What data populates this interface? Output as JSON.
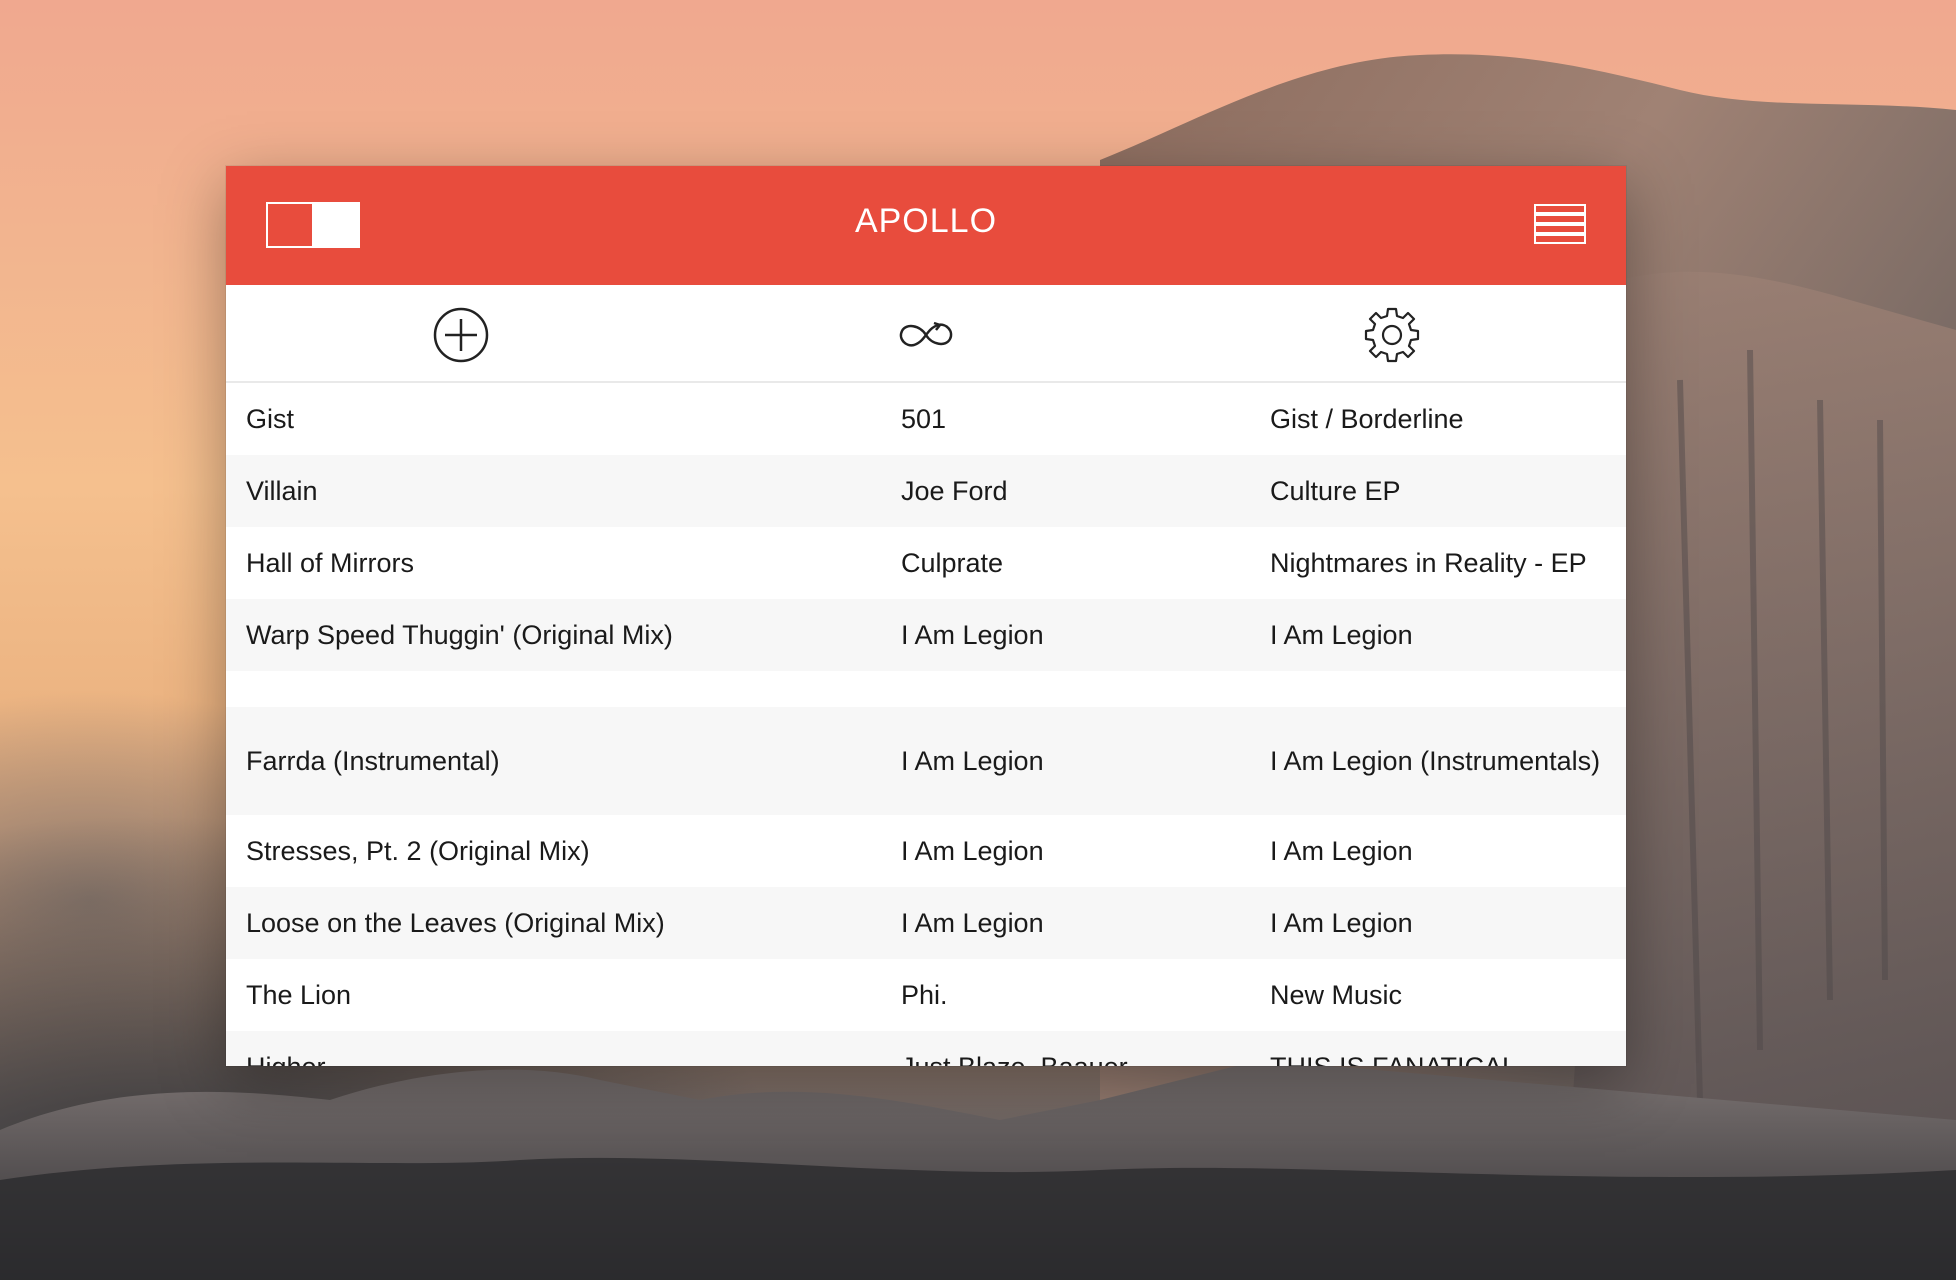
{
  "window": {
    "title": "APOLLO",
    "accent_color": "#e84c3d",
    "toggle_icon": "panel-toggle-icon",
    "menu_icon": "hamburger-menu-icon"
  },
  "toolbar": {
    "items": [
      {
        "icon": "add-circle-icon"
      },
      {
        "icon": "infinity-loop-icon"
      },
      {
        "icon": "gear-icon"
      }
    ]
  },
  "tracks": [
    {
      "title": "Gist",
      "artist": "501",
      "album": "Gist / Borderline"
    },
    {
      "title": "Villain",
      "artist": "Joe Ford",
      "album": "Culture EP"
    },
    {
      "title": "Hall of Mirrors",
      "artist": "Culprate",
      "album": "Nightmares in Reality - EP"
    },
    {
      "title": "Warp Speed Thuggin' (Original Mix)",
      "artist": "I Am Legion",
      "album": "I Am Legion"
    },
    {
      "title": "Farrda (Instrumental)",
      "artist": "I Am Legion",
      "album": "I Am Legion (Instrumentals)"
    },
    {
      "title": "Stresses, Pt. 2 (Original Mix)",
      "artist": "I Am Legion",
      "album": "I Am Legion"
    },
    {
      "title": "Loose on the Leaves (Original Mix)",
      "artist": "I Am Legion",
      "album": "I Am Legion"
    },
    {
      "title": "The Lion",
      "artist": "Phi.",
      "album": "New Music"
    },
    {
      "title": "Higher",
      "artist": "Just Blaze, Baauer",
      "album": "THIS IS FANATICAL"
    }
  ]
}
